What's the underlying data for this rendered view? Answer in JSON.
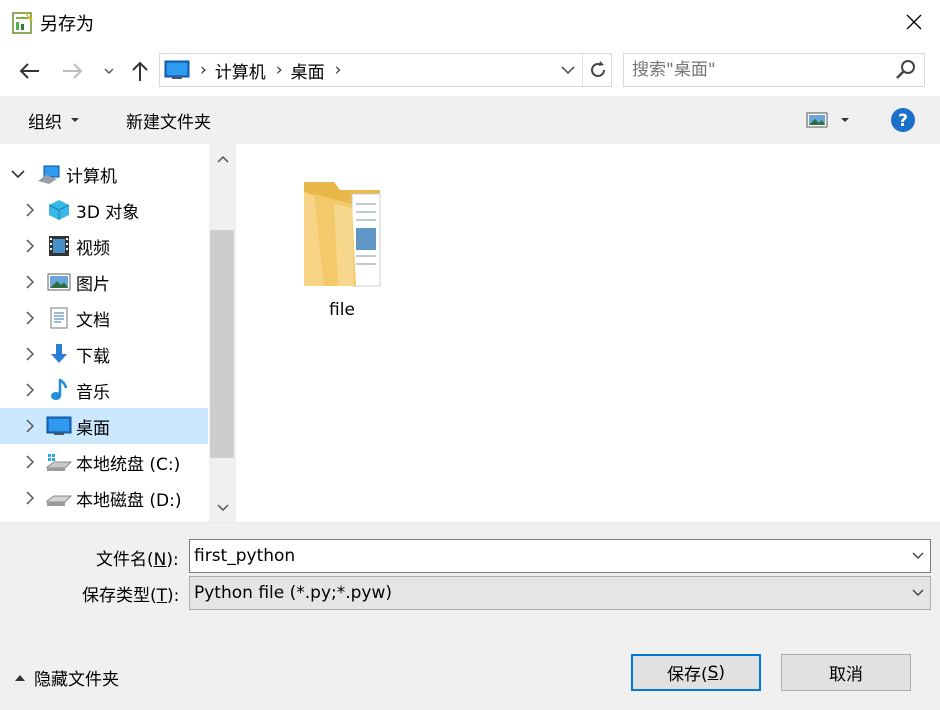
{
  "window": {
    "title": "另存为"
  },
  "address": {
    "crumbs": [
      "计算机",
      "桌面"
    ],
    "search_placeholder": "搜索\"桌面\""
  },
  "toolbar": {
    "organize_label": "组织",
    "new_folder_label": "新建文件夹"
  },
  "nav_pane": {
    "root": "计算机",
    "items": [
      {
        "label": "3D 对象",
        "icon": "cube-icon"
      },
      {
        "label": "视频",
        "icon": "video-icon"
      },
      {
        "label": "图片",
        "icon": "picture-icon"
      },
      {
        "label": "文档",
        "icon": "document-icon"
      },
      {
        "label": "下载",
        "icon": "download-icon"
      },
      {
        "label": "音乐",
        "icon": "music-icon"
      },
      {
        "label": "桌面",
        "icon": "desktop-icon",
        "selected": true
      },
      {
        "label": "本地统盘 (C:)",
        "icon": "drive-c-icon"
      },
      {
        "label": "本地磁盘 (D:)",
        "icon": "drive-d-icon"
      }
    ]
  },
  "content": {
    "items": [
      {
        "label": "file",
        "icon": "folder-icon"
      }
    ]
  },
  "form": {
    "filename_label_pre": "文件名(",
    "filename_label_key": "N",
    "filename_label_post": "):",
    "filename_value": "first_python",
    "type_label_pre": "保存类型(",
    "type_label_key": "T",
    "type_label_post": "):",
    "type_value": "Python file (*.py;*.pyw)"
  },
  "footer": {
    "hide_folders_label": "隐藏文件夹",
    "save_label_pre": "保存(",
    "save_label_key": "S",
    "save_label_post": ")",
    "cancel_label": "取消"
  },
  "colors": {
    "accent": "#0078d7",
    "selection": "#cce8ff",
    "panel": "#f0f0f0",
    "help": "#1a6fc9"
  }
}
